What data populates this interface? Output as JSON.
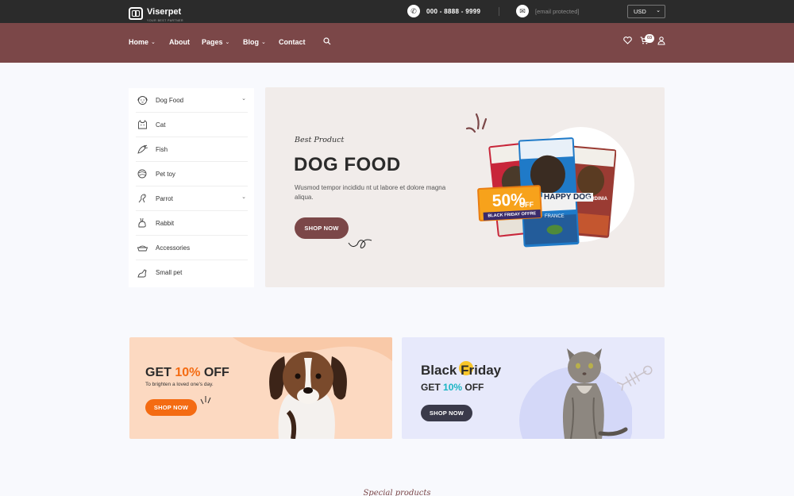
{
  "brand": {
    "name": "Viserpet",
    "tagline": "YOUR BEST PARTNER"
  },
  "topbar": {
    "phone": "000 - 8888 - 9999",
    "email": "[email protected]",
    "currency": "USD"
  },
  "nav": {
    "items": [
      {
        "label": "Home",
        "has_dropdown": true
      },
      {
        "label": "About",
        "has_dropdown": false
      },
      {
        "label": "Pages",
        "has_dropdown": true
      },
      {
        "label": "Blog",
        "has_dropdown": true
      },
      {
        "label": "Contact",
        "has_dropdown": false
      }
    ],
    "cart_count": "03"
  },
  "categories": [
    {
      "label": "Dog Food",
      "has_dropdown": true
    },
    {
      "label": "Cat",
      "has_dropdown": false
    },
    {
      "label": "Fish",
      "has_dropdown": false
    },
    {
      "label": "Pet toy",
      "has_dropdown": false
    },
    {
      "label": "Parrot",
      "has_dropdown": true
    },
    {
      "label": "Rabbit",
      "has_dropdown": false
    },
    {
      "label": "Accessories",
      "has_dropdown": false
    },
    {
      "label": "Small pet",
      "has_dropdown": false
    }
  ],
  "hero": {
    "eyebrow": "Best Product",
    "title": "DOG FOOD",
    "text": "Wusmod tempor incididu nt ut labore et dolore magna aliqua.",
    "button": "SHOP NOW",
    "badge_percent": "50%",
    "badge_off": "OFF",
    "badge_caption": "BLACK FRIDAY OFFRE",
    "bag_label": "HAPPY DOG",
    "bag_sub": "FRANCE",
    "bag_sub2": "SARDINIA"
  },
  "promos": {
    "left": {
      "title_a": "GET ",
      "title_b": "10%",
      "title_c": " OFF",
      "subtitle": "To brighten a loved one's day.",
      "button": "SHOP NOW"
    },
    "right": {
      "title_a": "Black ",
      "title_b": "Fr",
      "title_c": "iday",
      "sub_a": "GET ",
      "sub_b": "10%",
      "sub_c": " OFF",
      "button": "SHOP NOW"
    }
  },
  "section": {
    "title": "Special products"
  },
  "colors": {
    "brand": "#7b4748",
    "topbar": "#2b2b2b",
    "accent_orange": "#f46b12",
    "accent_teal": "#1cb5c4"
  }
}
